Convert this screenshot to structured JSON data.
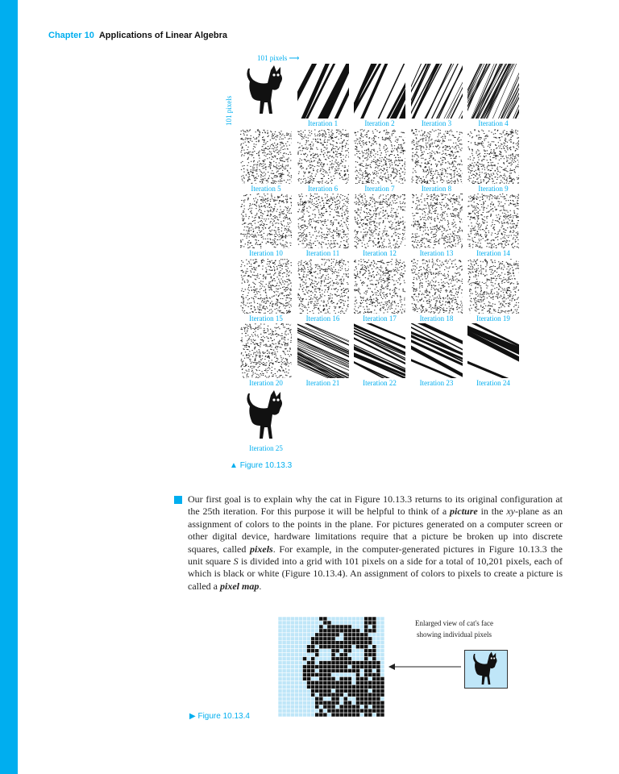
{
  "page_header": {
    "chapter": "Chapter 10",
    "title": "Applications of Linear Algebra"
  },
  "figure_1": {
    "top_label": "101 pixels",
    "side_label": "101 pixels",
    "captions": [
      "Iteration 1",
      "Iteration 2",
      "Iteration 3",
      "Iteration 4",
      "Iteration 5",
      "Iteration 6",
      "Iteration 7",
      "Iteration 8",
      "Iteration 9",
      "Iteration 10",
      "Iteration 11",
      "Iteration 12",
      "Iteration 13",
      "Iteration 14",
      "Iteration 15",
      "Iteration 16",
      "Iteration 17",
      "Iteration 18",
      "Iteration 19",
      "Iteration 20",
      "Iteration 21",
      "Iteration 22",
      "Iteration 23",
      "Iteration 24",
      "Iteration 25"
    ],
    "figure_label": "Figure 10.13.3"
  },
  "section": {
    "text_lead": "Our first goal is to explain why the cat in Figure 10.13.3 returns to its original configuration at the 25th iteration. For this purpose it will be helpful to think of a ",
    "term_picture": "picture",
    "text_a": " in the ",
    "var_xy": "xy",
    "text_b": "-plane as an assignment of colors to the points in the plane. For pictures generated on a computer screen or other digital device, hardware limitations require that a picture be broken up into discrete squares, called ",
    "term_pixels": "pixels",
    "text_c": ". For example, in the computer-generated pictures in Figure 10.13.3 the unit square ",
    "var_s": "S",
    "text_d": " is divided into a grid with 101 pixels on a side for a total of 10,201 pixels, each of which is black or white (Figure 10.13.4). An assignment of colors to pixels to create a picture is called a ",
    "term_pixel_map": "pixel map",
    "text_e": "."
  },
  "figure_4": {
    "note_line1": "Enlarged view of cat's face",
    "note_line2": "showing individual pixels",
    "figure_label": "Figure 10.13.4"
  },
  "colors": {
    "accent": "#00aeef",
    "text": "#222222",
    "pixel_bg": "#bfe6f8"
  }
}
